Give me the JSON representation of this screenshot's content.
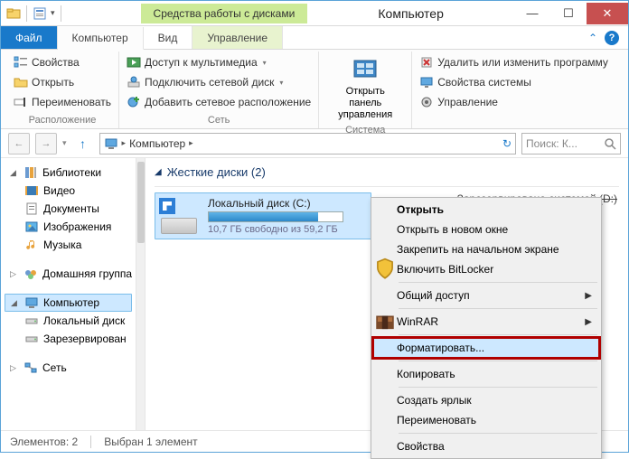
{
  "titlebar": {
    "tool_tab": "Средства работы с дисками",
    "title": "Компьютер"
  },
  "tabs": {
    "file": "Файл",
    "computer": "Компьютер",
    "view": "Вид",
    "manage": "Управление"
  },
  "ribbon": {
    "location": {
      "properties": "Свойства",
      "open": "Открыть",
      "rename": "Переименовать",
      "group": "Расположение"
    },
    "network": {
      "media": "Доступ к мультимедиа",
      "map_drive": "Подключить сетевой диск",
      "add_location": "Добавить сетевое расположение",
      "group": "Сеть"
    },
    "controlpanel": {
      "label": "Открыть панель управления"
    },
    "system": {
      "uninstall": "Удалить или изменить программу",
      "properties": "Свойства системы",
      "manage": "Управление",
      "group": "Система"
    }
  },
  "address": {
    "breadcrumb": "Компьютер",
    "search_placeholder": "Поиск: К..."
  },
  "nav": {
    "libraries": "Библиотеки",
    "video": "Видео",
    "documents": "Документы",
    "pictures": "Изображения",
    "music": "Музыка",
    "homegroup": "Домашняя группа",
    "computer": "Компьютер",
    "local_disk": "Локальный диск",
    "reserved": "Зарезервирован",
    "network": "Сеть"
  },
  "content": {
    "group_header": "Жесткие диски (2)",
    "disk_name": "Локальный диск (C:)",
    "disk_meta": "10,7 ГБ свободно из 59,2 ГБ",
    "disk_fill_percent": 82,
    "reserved_hint": "Зарезервировано системой (D:)"
  },
  "context_menu": {
    "open": "Открыть",
    "open_new": "Открыть в новом окне",
    "pin_start": "Закрепить на начальном экране",
    "bitlocker": "Включить BitLocker",
    "sharing": "Общий доступ",
    "winrar": "WinRAR",
    "format": "Форматировать...",
    "copy": "Копировать",
    "shortcut": "Создать ярлык",
    "rename": "Переименовать",
    "properties": "Свойства"
  },
  "statusbar": {
    "count": "Элементов: 2",
    "selected": "Выбран 1 элемент"
  }
}
